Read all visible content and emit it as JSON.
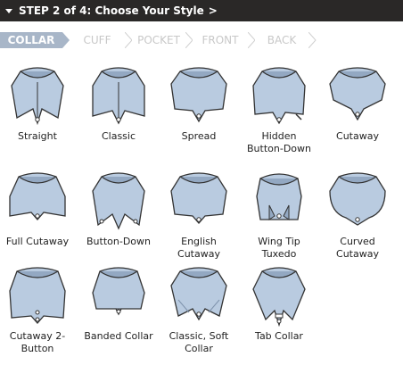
{
  "header": {
    "title": "STEP 2 of 4: Choose Your Style",
    "arrow": ">"
  },
  "tabs": [
    {
      "label": "COLLAR",
      "active": true
    },
    {
      "label": "CUFF",
      "active": false
    },
    {
      "label": "POCKET",
      "active": false
    },
    {
      "label": "FRONT",
      "active": false
    },
    {
      "label": "BACK",
      "active": false
    }
  ],
  "collars": [
    {
      "label": "Straight"
    },
    {
      "label": "Classic"
    },
    {
      "label": "Spread"
    },
    {
      "label": "Hidden Button-Down"
    },
    {
      "label": "Cutaway"
    },
    {
      "label": "Full Cutaway"
    },
    {
      "label": "Button-Down"
    },
    {
      "label": "English Cutaway"
    },
    {
      "label": "Wing Tip Tuxedo"
    },
    {
      "label": "Curved Cutaway"
    },
    {
      "label": "Cutaway 2-Button"
    },
    {
      "label": "Banded Collar"
    },
    {
      "label": "Classic, Soft Collar"
    },
    {
      "label": "Tab Collar"
    }
  ],
  "colors": {
    "header_bg": "#2a2827",
    "tab_active": "#a8b6c8",
    "collar_fill": "#b9cbe0",
    "collar_shadow": "#93a8c2"
  }
}
